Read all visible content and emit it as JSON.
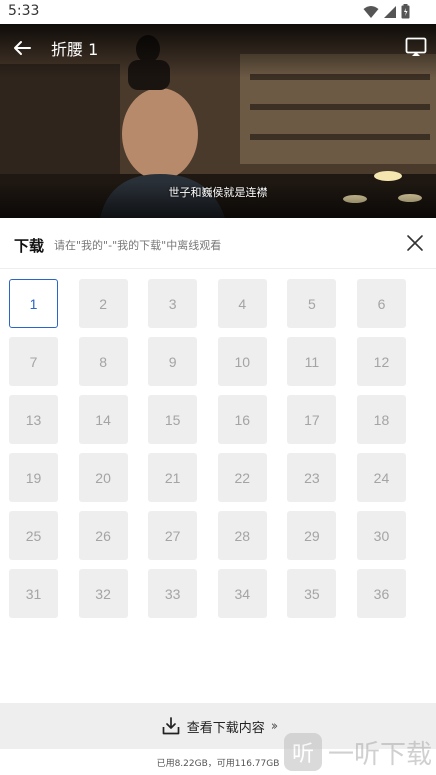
{
  "status_bar": {
    "time": "5:33"
  },
  "player": {
    "title": "折腰 1",
    "subtitle": "世子和巍侯就是连襟"
  },
  "download_panel": {
    "title": "下载",
    "hint": "请在\"我的\"-\"我的下载\"中离线观看",
    "selected_episode": "1",
    "episodes": [
      "1",
      "2",
      "3",
      "4",
      "5",
      "6",
      "7",
      "8",
      "9",
      "10",
      "11",
      "12",
      "13",
      "14",
      "15",
      "16",
      "17",
      "18",
      "19",
      "20",
      "21",
      "22",
      "23",
      "24",
      "25",
      "26",
      "27",
      "28",
      "29",
      "30",
      "31",
      "32",
      "33",
      "34",
      "35",
      "36"
    ]
  },
  "footer": {
    "view_downloads_label": "查看下载内容",
    "storage_text": "已用8.22GB，可用116.77GB"
  },
  "watermark": {
    "logo_text": "听",
    "text": "一听下载"
  },
  "colors": {
    "accent": "#2d64c8",
    "tile_bg": "#eeeeee",
    "tile_text": "#a4a4a4"
  },
  "icons": {
    "back": "arrow-left-icon",
    "cast": "cast-screen-icon",
    "close": "close-icon",
    "download": "download-icon"
  }
}
